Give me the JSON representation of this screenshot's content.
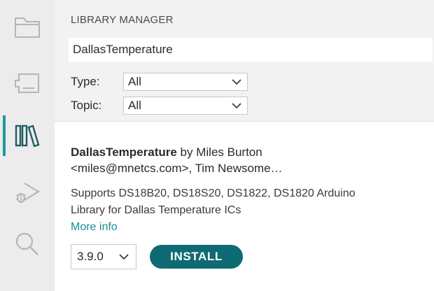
{
  "activity_bar": {
    "items": [
      {
        "icon": "folder-icon"
      },
      {
        "icon": "board-icon"
      },
      {
        "icon": "library-icon",
        "active": true
      },
      {
        "icon": "debug-icon"
      },
      {
        "icon": "search-icon"
      }
    ],
    "accent_color": "#1c9a9f"
  },
  "panel": {
    "title": "LIBRARY MANAGER",
    "search": {
      "value": "DallasTemperature"
    },
    "filters": {
      "type": {
        "label": "Type:",
        "value": "All"
      },
      "topic": {
        "label": "Topic:",
        "value": "All"
      }
    }
  },
  "library": {
    "name": "DallasTemperature",
    "by": "by Miles Burton",
    "authors_more": "<miles@mnetcs.com>, Tim Newsome…",
    "description_line1": "Supports DS18B20, DS18S20, DS1822, DS1820 Arduino",
    "description_line2": "Library for Dallas Temperature ICs",
    "more_info": "More info",
    "version": "3.9.0",
    "install_label": "INSTALL",
    "install_color": "#0e6b73",
    "link_color": "#1a8d93"
  }
}
